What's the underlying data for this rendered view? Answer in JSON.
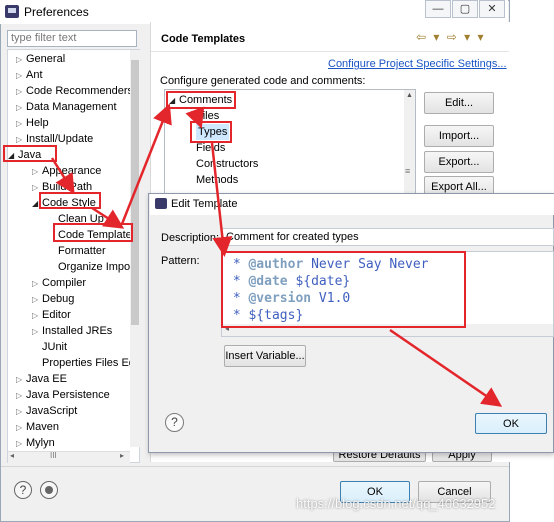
{
  "window": {
    "title": "Preferences",
    "caption_buttons": [
      "—",
      "▢",
      "✕"
    ]
  },
  "filter": {
    "placeholder": "type filter text"
  },
  "tree": {
    "items": [
      {
        "label": "General"
      },
      {
        "label": "Ant"
      },
      {
        "label": "Code Recommenders"
      },
      {
        "label": "Data Management"
      },
      {
        "label": "Help"
      },
      {
        "label": "Install/Update"
      },
      {
        "label": "Java"
      },
      {
        "label": "Appearance"
      },
      {
        "label": "Build Path"
      },
      {
        "label": "Code Style"
      },
      {
        "label": "Clean Up"
      },
      {
        "label": "Code Templates"
      },
      {
        "label": "Formatter"
      },
      {
        "label": "Organize Impo"
      },
      {
        "label": "Compiler"
      },
      {
        "label": "Debug"
      },
      {
        "label": "Editor"
      },
      {
        "label": "Installed JREs"
      },
      {
        "label": "JUnit"
      },
      {
        "label": "Properties Files Ed"
      },
      {
        "label": "Java EE"
      },
      {
        "label": "Java Persistence"
      },
      {
        "label": "JavaScript"
      },
      {
        "label": "Maven"
      },
      {
        "label": "Mylyn"
      }
    ],
    "hscroll_label": "III"
  },
  "right": {
    "title": "Code Templates",
    "nav_arrows": "⇦ ▾ ⇨ ▾ ▾",
    "config_link": "Configure Project Specific Settings...",
    "config_text": "Configure generated code and comments:",
    "templates": [
      {
        "label": "Comments"
      },
      {
        "label": "Files"
      },
      {
        "label": "Types"
      },
      {
        "label": "Fields"
      },
      {
        "label": "Constructors"
      },
      {
        "label": "Methods"
      }
    ],
    "buttons": {
      "edit": "Edit...",
      "import": "Import...",
      "export": "Export...",
      "export_all": "Export All..."
    },
    "restore_defaults": "Restore Defaults",
    "apply": "Apply"
  },
  "dialog": {
    "title": "Edit Template",
    "description_label": "Description:",
    "description_value": "Comment for created types",
    "pattern_label": "Pattern:",
    "pattern_lines": [
      {
        "prefix": " * ",
        "tag": "@author",
        "rest": " Never Say Never"
      },
      {
        "prefix": " * ",
        "tag": "@date",
        "rest": " ${date}"
      },
      {
        "prefix": " * ",
        "tag": "@version",
        "rest": " V1.0"
      },
      {
        "prefix": " * ",
        "tag": "",
        "rest": "${tags}"
      }
    ],
    "insert_variable": "Insert Variable...",
    "ok": "OK",
    "help": "?"
  },
  "bottom": {
    "ok": "OK",
    "cancel": "Cancel",
    "help": "?"
  },
  "watermark": "https://blog.csdn.net/qq_40632952",
  "colors": {
    "highlight_red": "#e3262b",
    "link_blue": "#1a55c4",
    "javadoc_blue": "#3f5fbf",
    "selection_blue": "#cde8ff"
  }
}
